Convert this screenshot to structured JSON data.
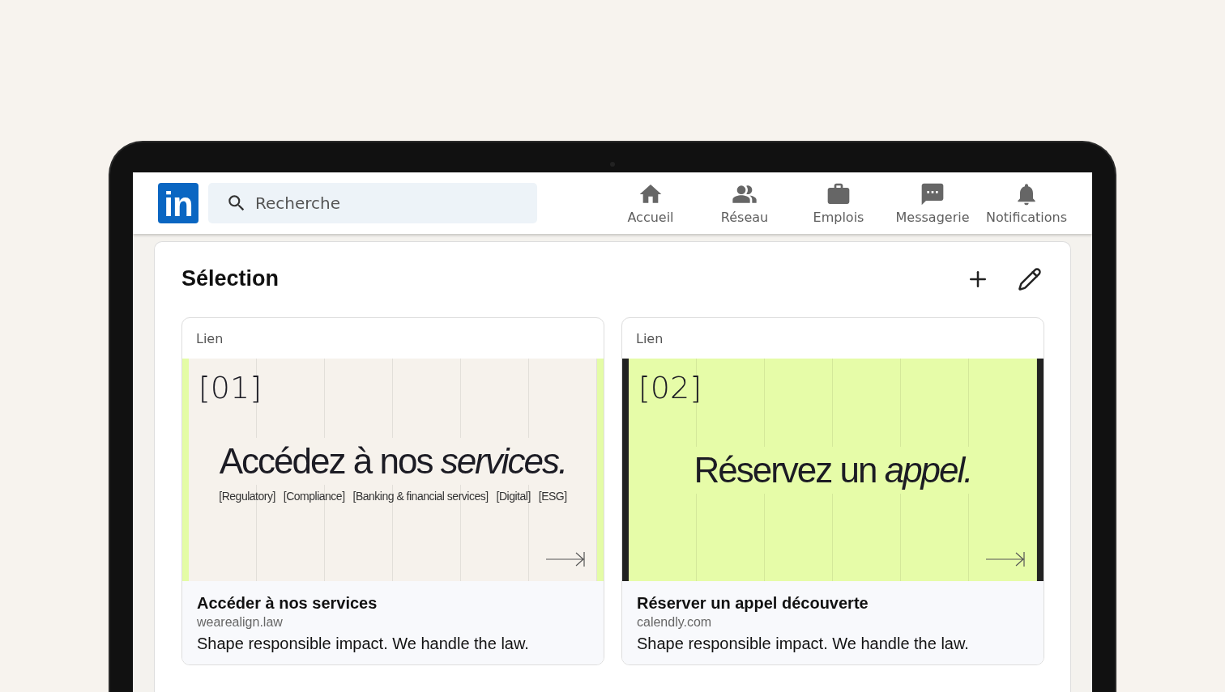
{
  "navbar": {
    "logo": "in",
    "search": {
      "placeholder": "Recherche"
    },
    "items": [
      {
        "label": "Accueil"
      },
      {
        "label": "Réseau"
      },
      {
        "label": "Emplois"
      },
      {
        "label": "Messagerie"
      },
      {
        "label": "Notifications"
      }
    ]
  },
  "section": {
    "title": "Sélection",
    "cards": [
      {
        "type": "Lien",
        "banner": {
          "kind": "cream",
          "number": "[01]",
          "headline": "Accédez à nos *services.*",
          "tags": [
            "[Regulatory]",
            "[Compliance]",
            "[Banking & financial services]",
            "[Digital]",
            "[ESG]"
          ]
        },
        "title": "Accéder à nos services",
        "domain": "wearealign.law",
        "description": "Shape responsible impact. We handle the law."
      },
      {
        "type": "Lien",
        "banner": {
          "kind": "lime",
          "number": "[02]",
          "headline": "Réservez un *appel.*"
        },
        "title": "Réserver un appel découverte",
        "domain": "calendly.com",
        "description": "Shape responsible impact. We handle the law."
      }
    ]
  }
}
